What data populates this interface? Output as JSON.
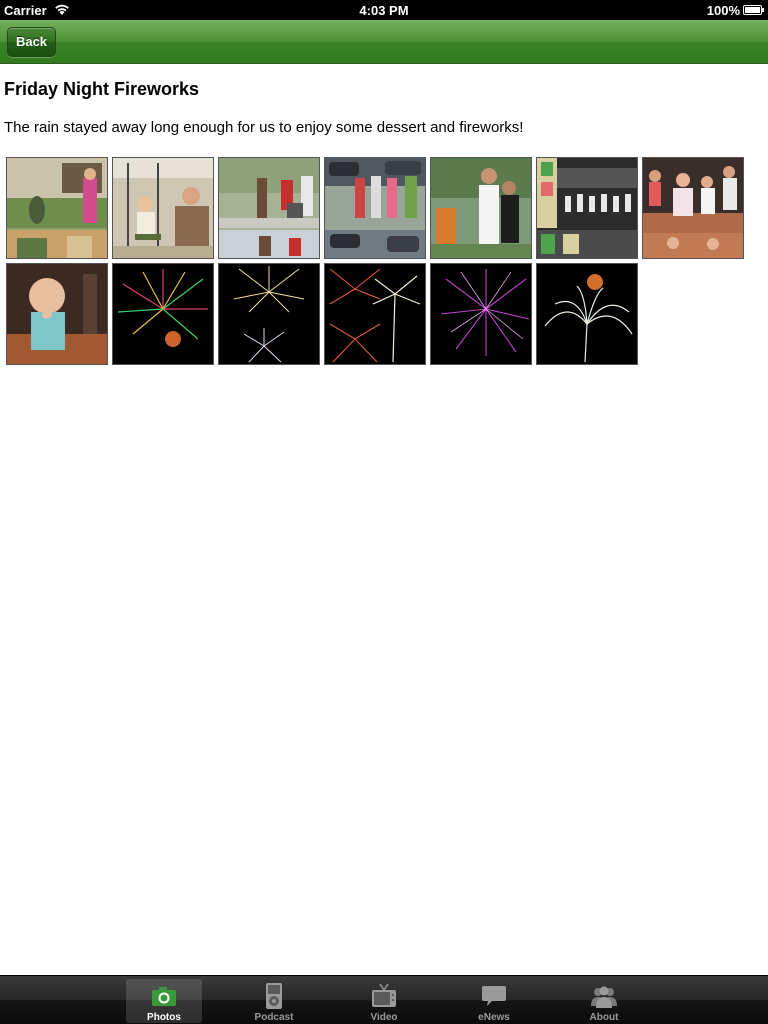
{
  "status_bar": {
    "carrier": "Carrier",
    "time": "4:03 PM",
    "battery": "100%"
  },
  "nav_bar": {
    "back_label": "Back"
  },
  "page": {
    "title": "Friday Night Fireworks",
    "description": "The rain stayed away long enough for us to enjoy some dessert and fireworks!"
  },
  "tabs": [
    {
      "label": "Photos",
      "icon": "camera-icon",
      "selected": true
    },
    {
      "label": "Podcast",
      "icon": "ipod-icon",
      "selected": false
    },
    {
      "label": "Video",
      "icon": "tv-icon",
      "selected": false
    },
    {
      "label": "eNews",
      "icon": "speech-bubble-icon",
      "selected": false
    },
    {
      "label": "About",
      "icon": "people-icon",
      "selected": false
    }
  ],
  "colors": {
    "nav_green": "#3c8427",
    "tab_selected_label": "#ffffff",
    "tab_label": "#9a9a9a"
  }
}
